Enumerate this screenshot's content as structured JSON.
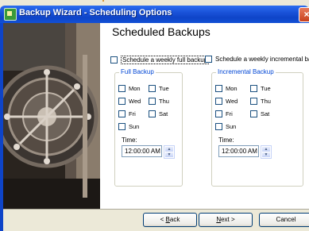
{
  "window": {
    "title": "Backup Wizard - Scheduling Options",
    "close_glyph": "×",
    "icon": "wizard-app-icon"
  },
  "page": {
    "heading": "Scheduled Backups"
  },
  "options": {
    "weekly_full_label": "Schedule a weekly full backup",
    "weekly_full_checked": false,
    "weekly_incremental_label": "Schedule a weekly incremental backup",
    "weekly_incremental_checked": false
  },
  "full_backup": {
    "title": "Full Backup",
    "days": [
      {
        "label": "Mon",
        "checked": false
      },
      {
        "label": "Tue",
        "checked": false
      },
      {
        "label": "Wed",
        "checked": false
      },
      {
        "label": "Thu",
        "checked": false
      },
      {
        "label": "Fri",
        "checked": false
      },
      {
        "label": "Sat",
        "checked": false
      },
      {
        "label": "Sun",
        "checked": false
      }
    ],
    "time_label": "Time:",
    "time_value": "12:00:00 AM"
  },
  "incremental_backup": {
    "title": "Incremental Backup",
    "days": [
      {
        "label": "Mon",
        "checked": false
      },
      {
        "label": "Tue",
        "checked": false
      },
      {
        "label": "Wed",
        "checked": false
      },
      {
        "label": "Thu",
        "checked": false
      },
      {
        "label": "Fri",
        "checked": false
      },
      {
        "label": "Sat",
        "checked": false
      },
      {
        "label": "Sun",
        "checked": false
      }
    ],
    "time_label": "Time:",
    "time_value": "12:00:00 AM"
  },
  "buttons": {
    "back_prefix": "< ",
    "back_mnemonic": "B",
    "back_rest": "ack",
    "next_mnemonic": "N",
    "next_rest": "ext >",
    "cancel_label": "Cancel"
  },
  "colors": {
    "titlebar": "#0e44c8",
    "group_title": "#0046d5",
    "dialog_face": "#ece9d8"
  }
}
